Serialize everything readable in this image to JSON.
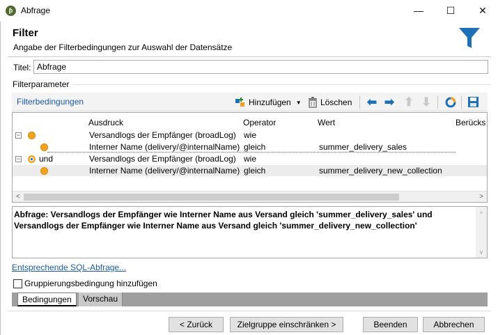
{
  "window": {
    "title": "Abfrage",
    "minimize": "—",
    "maximize": "☐",
    "close": "✕"
  },
  "header": {
    "title": "Filter",
    "subtitle": "Angabe der Filterbedingungen zur Auswahl der Datensätze"
  },
  "form": {
    "title_label": "Titel:",
    "title_value": "Abfrage",
    "params_label": "Filterparameter"
  },
  "toolbar": {
    "section_link": "Filterbedingungen",
    "add_label": "Hinzufügen",
    "delete_label": "Löschen"
  },
  "grid": {
    "columns": [
      "Ausdruck",
      "Operator",
      "Wert",
      "Berücks"
    ],
    "rows": [
      {
        "prefix": "",
        "expression": "Versandlogs der Empfänger (broadLog)",
        "operator": "wie",
        "value": ""
      },
      {
        "prefix": "",
        "expression": "Interner Name (delivery/@internalName)",
        "operator": "gleich",
        "value": "summer_delivery_sales"
      },
      {
        "prefix": "und",
        "expression": "Versandlogs der Empfänger (broadLog)",
        "operator": "wie",
        "value": ""
      },
      {
        "prefix": "",
        "expression": "Interner Name (delivery/@internalName)",
        "operator": "gleich",
        "value": "summer_delivery_new_collection"
      }
    ]
  },
  "description": "Abfrage: Versandlogs der Empfänger wie Interner Name aus Versand gleich 'summer_delivery_sales' und Versandlogs der Empfänger wie Interner Name aus Versand gleich 'summer_delivery_new_collection'",
  "sql_link": "Entsprechende SQL-Abfrage...",
  "group_checkbox": {
    "label": "Gruppierungsbedingung hinzufügen",
    "checked": false
  },
  "tabs": [
    "Bedingungen",
    "Vorschau"
  ],
  "footer": {
    "back": "< Zurück",
    "restrict": "Zielgruppe einschränken >",
    "finish": "Beenden",
    "cancel": "Abbrechen"
  },
  "colors": {
    "accent": "#1c5aa6",
    "dot": "#f3a21e",
    "funnel": "#1d6fb8"
  }
}
